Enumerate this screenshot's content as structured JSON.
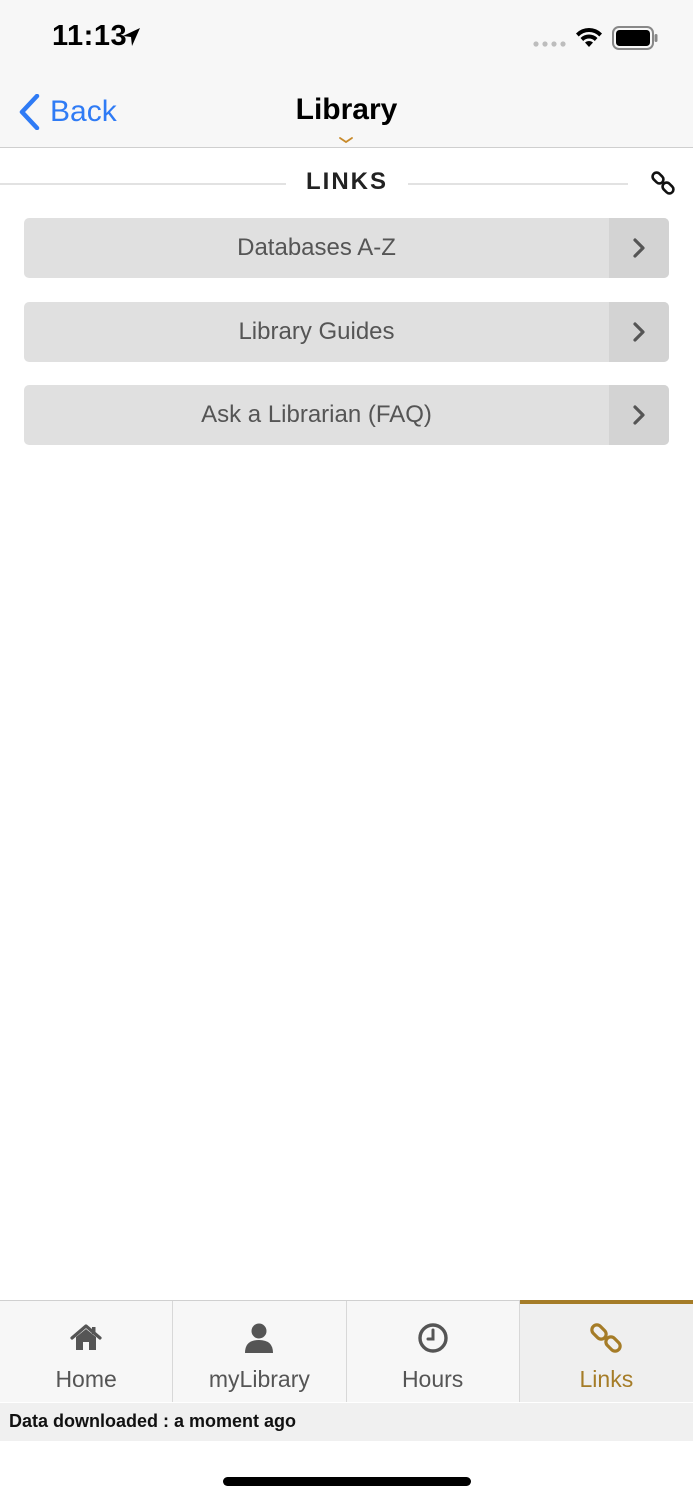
{
  "status_bar": {
    "time": "11:13"
  },
  "nav": {
    "back_label": "Back",
    "title": "Library"
  },
  "section": {
    "title": "LINKS"
  },
  "links": [
    {
      "label": "Databases A-Z"
    },
    {
      "label": "Library Guides"
    },
    {
      "label": "Ask a Librarian (FAQ)"
    }
  ],
  "tabs": [
    {
      "label": "Home",
      "icon": "home-icon"
    },
    {
      "label": "myLibrary",
      "icon": "user-icon"
    },
    {
      "label": "Hours",
      "icon": "clock-icon"
    },
    {
      "label": "Links",
      "icon": "link-icon",
      "active": true
    }
  ],
  "footer": {
    "data_status": "Data downloaded : a moment ago"
  },
  "colors": {
    "accent": "#a57c27",
    "ios_blue": "#2f7bf5",
    "button_bg": "#e0e0e0"
  }
}
